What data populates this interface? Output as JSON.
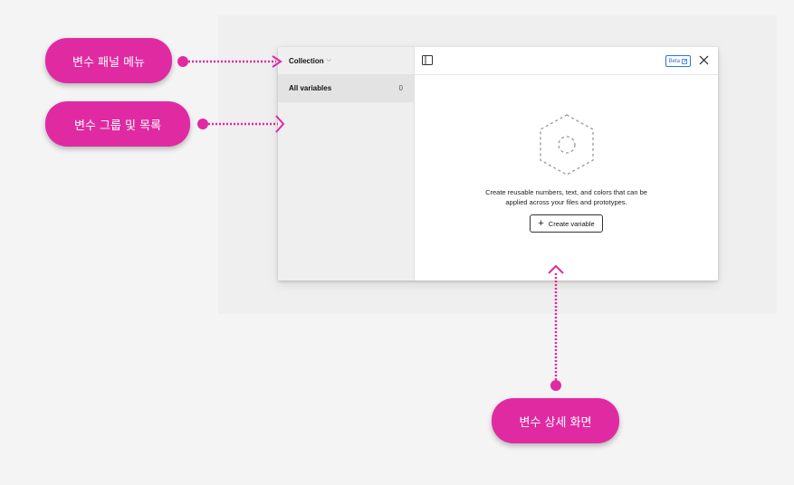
{
  "sidebar": {
    "collection_label": "Collection",
    "chevron": "⌄",
    "row_label": "All variables",
    "row_count": "0"
  },
  "header": {
    "sidebar_toggle_icon": "panel-toggle-icon",
    "beta_label": "Beta",
    "beta_icon": "external-link-icon",
    "close_icon": "close-icon"
  },
  "empty_state": {
    "icon": "dashed-hexagon-icon",
    "line1": "Create reusable numbers, text, and colors that can be",
    "line2": "applied across your files and prototypes.",
    "button_icon": "plus-icon",
    "button_label": "Create variable"
  },
  "annotations": {
    "panel_menu": "변수 패널 메뉴",
    "groups_list": "변수 그룹 및 목록",
    "detail_view": "변수 상세 화면",
    "color": "#e02aa2"
  }
}
